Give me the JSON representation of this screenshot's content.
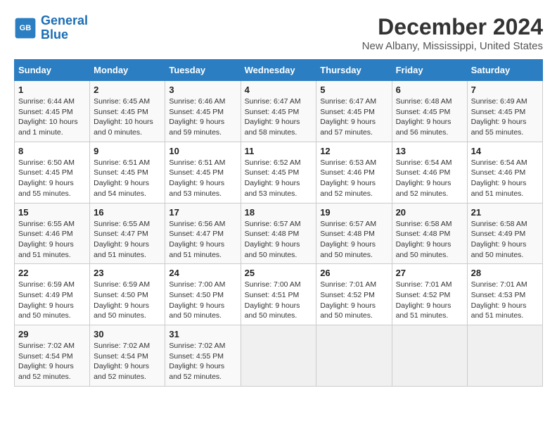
{
  "logo": {
    "line1": "General",
    "line2": "Blue"
  },
  "title": "December 2024",
  "subtitle": "New Albany, Mississippi, United States",
  "headers": [
    "Sunday",
    "Monday",
    "Tuesday",
    "Wednesday",
    "Thursday",
    "Friday",
    "Saturday"
  ],
  "weeks": [
    [
      {
        "day": "1",
        "info": "Sunrise: 6:44 AM\nSunset: 4:45 PM\nDaylight: 10 hours\nand 1 minute."
      },
      {
        "day": "2",
        "info": "Sunrise: 6:45 AM\nSunset: 4:45 PM\nDaylight: 10 hours\nand 0 minutes."
      },
      {
        "day": "3",
        "info": "Sunrise: 6:46 AM\nSunset: 4:45 PM\nDaylight: 9 hours\nand 59 minutes."
      },
      {
        "day": "4",
        "info": "Sunrise: 6:47 AM\nSunset: 4:45 PM\nDaylight: 9 hours\nand 58 minutes."
      },
      {
        "day": "5",
        "info": "Sunrise: 6:47 AM\nSunset: 4:45 PM\nDaylight: 9 hours\nand 57 minutes."
      },
      {
        "day": "6",
        "info": "Sunrise: 6:48 AM\nSunset: 4:45 PM\nDaylight: 9 hours\nand 56 minutes."
      },
      {
        "day": "7",
        "info": "Sunrise: 6:49 AM\nSunset: 4:45 PM\nDaylight: 9 hours\nand 55 minutes."
      }
    ],
    [
      {
        "day": "8",
        "info": "Sunrise: 6:50 AM\nSunset: 4:45 PM\nDaylight: 9 hours\nand 55 minutes."
      },
      {
        "day": "9",
        "info": "Sunrise: 6:51 AM\nSunset: 4:45 PM\nDaylight: 9 hours\nand 54 minutes."
      },
      {
        "day": "10",
        "info": "Sunrise: 6:51 AM\nSunset: 4:45 PM\nDaylight: 9 hours\nand 53 minutes."
      },
      {
        "day": "11",
        "info": "Sunrise: 6:52 AM\nSunset: 4:45 PM\nDaylight: 9 hours\nand 53 minutes."
      },
      {
        "day": "12",
        "info": "Sunrise: 6:53 AM\nSunset: 4:46 PM\nDaylight: 9 hours\nand 52 minutes."
      },
      {
        "day": "13",
        "info": "Sunrise: 6:54 AM\nSunset: 4:46 PM\nDaylight: 9 hours\nand 52 minutes."
      },
      {
        "day": "14",
        "info": "Sunrise: 6:54 AM\nSunset: 4:46 PM\nDaylight: 9 hours\nand 51 minutes."
      }
    ],
    [
      {
        "day": "15",
        "info": "Sunrise: 6:55 AM\nSunset: 4:46 PM\nDaylight: 9 hours\nand 51 minutes."
      },
      {
        "day": "16",
        "info": "Sunrise: 6:55 AM\nSunset: 4:47 PM\nDaylight: 9 hours\nand 51 minutes."
      },
      {
        "day": "17",
        "info": "Sunrise: 6:56 AM\nSunset: 4:47 PM\nDaylight: 9 hours\nand 51 minutes."
      },
      {
        "day": "18",
        "info": "Sunrise: 6:57 AM\nSunset: 4:48 PM\nDaylight: 9 hours\nand 50 minutes."
      },
      {
        "day": "19",
        "info": "Sunrise: 6:57 AM\nSunset: 4:48 PM\nDaylight: 9 hours\nand 50 minutes."
      },
      {
        "day": "20",
        "info": "Sunrise: 6:58 AM\nSunset: 4:48 PM\nDaylight: 9 hours\nand 50 minutes."
      },
      {
        "day": "21",
        "info": "Sunrise: 6:58 AM\nSunset: 4:49 PM\nDaylight: 9 hours\nand 50 minutes."
      }
    ],
    [
      {
        "day": "22",
        "info": "Sunrise: 6:59 AM\nSunset: 4:49 PM\nDaylight: 9 hours\nand 50 minutes."
      },
      {
        "day": "23",
        "info": "Sunrise: 6:59 AM\nSunset: 4:50 PM\nDaylight: 9 hours\nand 50 minutes."
      },
      {
        "day": "24",
        "info": "Sunrise: 7:00 AM\nSunset: 4:50 PM\nDaylight: 9 hours\nand 50 minutes."
      },
      {
        "day": "25",
        "info": "Sunrise: 7:00 AM\nSunset: 4:51 PM\nDaylight: 9 hours\nand 50 minutes."
      },
      {
        "day": "26",
        "info": "Sunrise: 7:01 AM\nSunset: 4:52 PM\nDaylight: 9 hours\nand 50 minutes."
      },
      {
        "day": "27",
        "info": "Sunrise: 7:01 AM\nSunset: 4:52 PM\nDaylight: 9 hours\nand 51 minutes."
      },
      {
        "day": "28",
        "info": "Sunrise: 7:01 AM\nSunset: 4:53 PM\nDaylight: 9 hours\nand 51 minutes."
      }
    ],
    [
      {
        "day": "29",
        "info": "Sunrise: 7:02 AM\nSunset: 4:54 PM\nDaylight: 9 hours\nand 52 minutes."
      },
      {
        "day": "30",
        "info": "Sunrise: 7:02 AM\nSunset: 4:54 PM\nDaylight: 9 hours\nand 52 minutes."
      },
      {
        "day": "31",
        "info": "Sunrise: 7:02 AM\nSunset: 4:55 PM\nDaylight: 9 hours\nand 52 minutes."
      },
      null,
      null,
      null,
      null
    ]
  ]
}
